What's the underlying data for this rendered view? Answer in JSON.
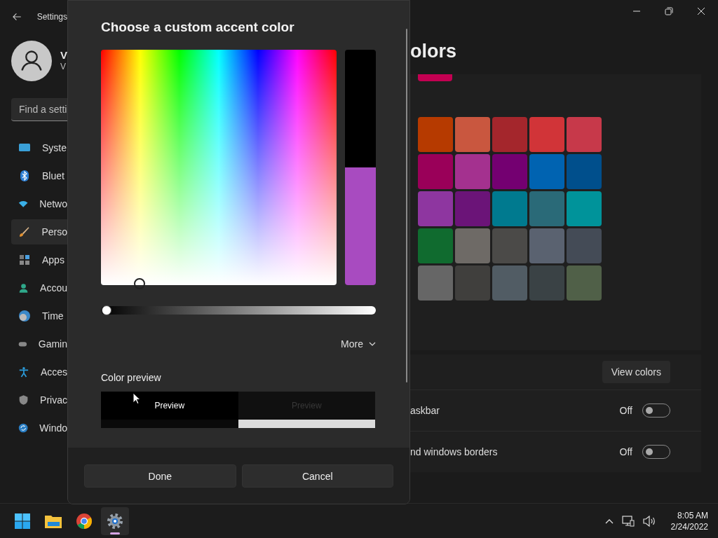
{
  "settings_window": {
    "title": "Settings"
  },
  "profile": {
    "name": "V",
    "email": "V"
  },
  "search": {
    "placeholder": "Find a setti"
  },
  "sidebar": {
    "items": [
      {
        "label": "Syste",
        "selected": false
      },
      {
        "label": "Bluet",
        "selected": false
      },
      {
        "label": "Netwo",
        "selected": false
      },
      {
        "label": "Perso",
        "selected": true
      },
      {
        "label": "Apps",
        "selected": false
      },
      {
        "label": "Accou",
        "selected": false
      },
      {
        "label": "Time",
        "selected": false
      },
      {
        "label": "Gamin",
        "selected": false
      },
      {
        "label": "Acces",
        "selected": false
      },
      {
        "label": "Privac",
        "selected": false
      },
      {
        "label": "Windo",
        "selected": false
      }
    ]
  },
  "main": {
    "title": "olors",
    "recent_colors": [
      {
        "color": "#c30052"
      }
    ],
    "swatches": [
      {
        "color": "#b63a00"
      },
      {
        "color": "#c9573f"
      },
      {
        "color": "#a4262c"
      },
      {
        "color": "#d13438"
      },
      {
        "color": "#c7394a"
      },
      {
        "color": "#9a0059"
      },
      {
        "color": "#a4318f"
      },
      {
        "color": "#740071"
      },
      {
        "color": "#0063b1"
      },
      {
        "color": "#004f8c"
      },
      {
        "color": "#8e36a0"
      },
      {
        "color": "#6b1478"
      },
      {
        "color": "#007a8f"
      },
      {
        "color": "#2a6a78"
      },
      {
        "color": "#00939a"
      },
      {
        "color": "#106b2f"
      },
      {
        "color": "#6e6a66"
      },
      {
        "color": "#4b4a48"
      },
      {
        "color": "#5a6270"
      },
      {
        "color": "#444b56"
      },
      {
        "color": "#666666"
      },
      {
        "color": "#403f3d"
      },
      {
        "color": "#515c64"
      },
      {
        "color": "#3a4245"
      },
      {
        "color": "#506048"
      }
    ],
    "view_colors_button": "View colors",
    "toggle_rows": [
      {
        "label": "askbar",
        "state_text": "Off",
        "on": false
      },
      {
        "label": "nd windows borders",
        "state_text": "Off",
        "on": false
      }
    ]
  },
  "dialog": {
    "title": "Choose a custom accent color",
    "value_slider": {
      "level": 0.02
    },
    "more_button": "More",
    "color_preview": {
      "label": "Color preview",
      "tiles": [
        {
          "text": "Preview",
          "kind": "dark"
        },
        {
          "text": "Preview",
          "kind": "light"
        }
      ]
    },
    "buttons": [
      "Done",
      "Cancel"
    ]
  },
  "taskbar": {
    "apps": [
      {
        "selected": false
      },
      {
        "selected": false
      },
      {
        "selected": false
      },
      {
        "selected": true
      }
    ],
    "time": "8:05 AM",
    "date": "2/24/2022"
  }
}
